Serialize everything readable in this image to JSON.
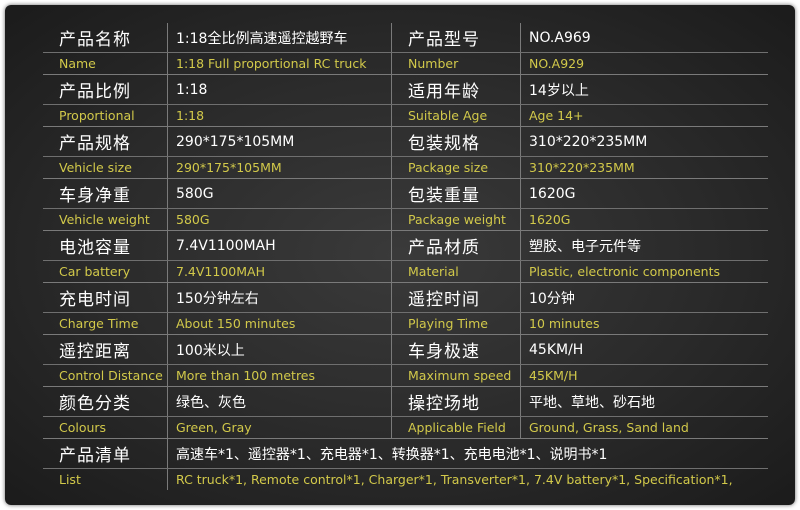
{
  "rows": [
    {
      "cn_label": "产品名称",
      "cn_value": "1:18全比例高速遥控越野车",
      "cn_label2": "产品型号",
      "cn_value2": "NO.A969",
      "en_label": "Name",
      "en_value": "1:18 Full proportional RC truck",
      "en_label2": "Number",
      "en_value2": "NO.A929"
    },
    {
      "cn_label": "产品比例",
      "cn_value": "1:18",
      "cn_label2": "适用年龄",
      "cn_value2": "14岁以上",
      "en_label": "Proportional",
      "en_value": "1:18",
      "en_label2": "Suitable Age",
      "en_value2": "Age 14+"
    },
    {
      "cn_label": "产品规格",
      "cn_value": "290*175*105MM",
      "cn_label2": "包装规格",
      "cn_value2": "310*220*235MM",
      "en_label": "Vehicle size",
      "en_value": "290*175*105MM",
      "en_label2": "Package size",
      "en_value2": "310*220*235MM"
    },
    {
      "cn_label": "车身净重",
      "cn_value": "580G",
      "cn_label2": "包装重量",
      "cn_value2": "1620G",
      "en_label": "Vehicle weight",
      "en_value": "580G",
      "en_label2": "Package weight",
      "en_value2": "1620G"
    },
    {
      "cn_label": "电池容量",
      "cn_value": "7.4V1100MAH",
      "cn_label2": "产品材质",
      "cn_value2": "塑胶、电子元件等",
      "en_label": "Car battery",
      "en_value": "7.4V1100MAH",
      "en_label2": "Material",
      "en_value2": "Plastic, electronic components"
    },
    {
      "cn_label": "充电时间",
      "cn_value": "150分钟左右",
      "cn_label2": "遥控时间",
      "cn_value2": "10分钟",
      "en_label": "Charge Time",
      "en_value": "About 150 minutes",
      "en_label2": "Playing Time",
      "en_value2": "10 minutes"
    },
    {
      "cn_label": "遥控距离",
      "cn_value": "100米以上",
      "cn_label2": "车身极速",
      "cn_value2": "45KM/H",
      "en_label": "Control Distance",
      "en_value": "More than 100 metres",
      "en_label2": "Maximum speed",
      "en_value2": "45KM/H"
    },
    {
      "cn_label": "颜色分类",
      "cn_value": "绿色、灰色",
      "cn_label2": "操控场地",
      "cn_value2": "平地、草地、砂石地",
      "en_label": "Colours",
      "en_value": "Green, Gray",
      "en_label2": "Applicable Field",
      "en_value2": "Ground, Grass, Sand land"
    }
  ],
  "list_row": {
    "cn_label": "产品清单",
    "cn_value": "高速车*1、遥控器*1、充电器*1、转换器*1、充电电池*1、说明书*1",
    "en_label": "List",
    "en_value": "RC truck*1, Remote control*1,  Charger*1, Transverter*1, 7.4V  battery*1,  Specification*1,"
  }
}
